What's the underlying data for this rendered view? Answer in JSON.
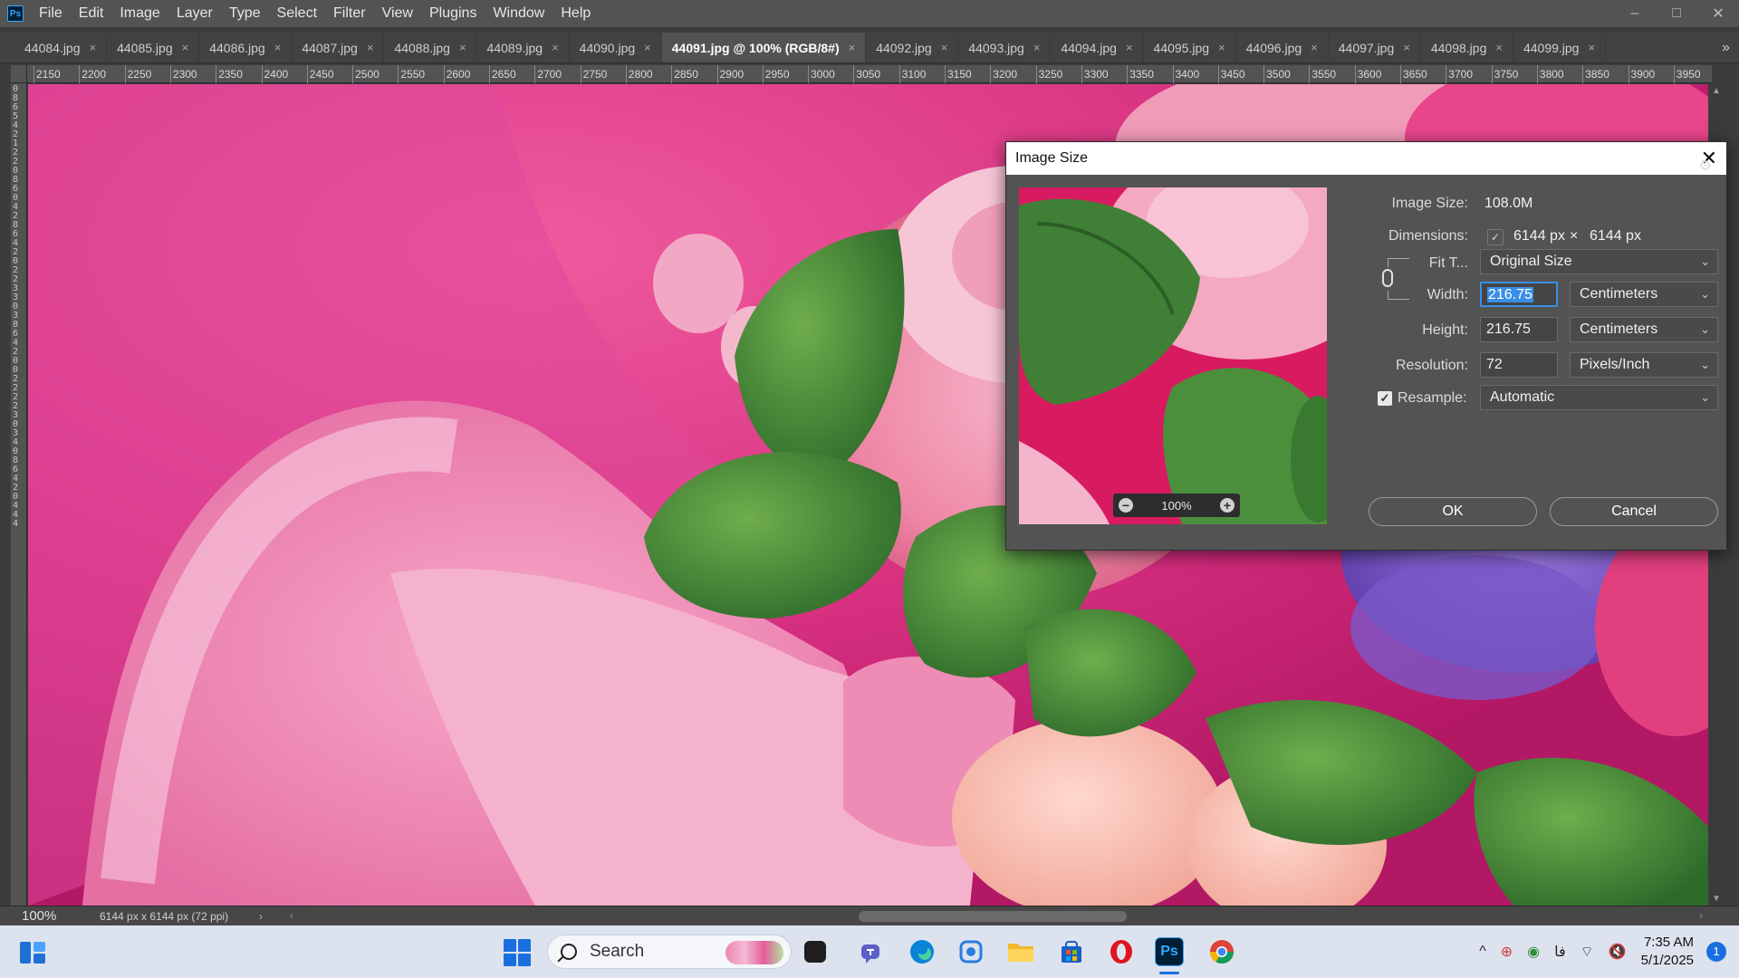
{
  "app": {
    "logo": "Ps",
    "menu": [
      "File",
      "Edit",
      "Image",
      "Layer",
      "Type",
      "Select",
      "Filter",
      "View",
      "Plugins",
      "Window",
      "Help"
    ],
    "window_controls": {
      "minimize": "–",
      "maximize": "□",
      "close": "✕"
    }
  },
  "tabs": [
    {
      "label": "44084.jpg",
      "active": false
    },
    {
      "label": "44085.jpg",
      "active": false
    },
    {
      "label": "44086.jpg",
      "active": false
    },
    {
      "label": "44087.jpg",
      "active": false
    },
    {
      "label": "44088.jpg",
      "active": false
    },
    {
      "label": "44089.jpg",
      "active": false
    },
    {
      "label": "44090.jpg",
      "active": false
    },
    {
      "label": "44091.jpg @ 100% (RGB/8#)",
      "active": true
    },
    {
      "label": "44092.jpg",
      "active": false
    },
    {
      "label": "44093.jpg",
      "active": false
    },
    {
      "label": "44094.jpg",
      "active": false
    },
    {
      "label": "44095.jpg",
      "active": false
    },
    {
      "label": "44096.jpg",
      "active": false
    },
    {
      "label": "44097.jpg",
      "active": false
    },
    {
      "label": "44098.jpg",
      "active": false
    },
    {
      "label": "44099.jpg",
      "active": false
    }
  ],
  "tab_close": "×",
  "tab_overflow": "»",
  "ruler_top": [
    "2150",
    "2200",
    "2250",
    "2300",
    "2350",
    "2400",
    "2450",
    "2500",
    "2550",
    "2600",
    "2650",
    "2700",
    "2750",
    "2800",
    "2850",
    "2900",
    "2950",
    "3000",
    "3050",
    "3100",
    "3150",
    "3200",
    "3250",
    "3300",
    "3350",
    "3400",
    "3450",
    "3500",
    "3550",
    "3600",
    "3650",
    "3700",
    "3750",
    "3800",
    "3850",
    "3900",
    "3950"
  ],
  "ruler_left_digits": "0865421220860428642022330386420022223034086420444",
  "status": {
    "zoom": "100%",
    "doc_info": "6144 px x 6144 px (72 ppi)",
    "arrow": "›"
  },
  "dialog": {
    "title": "Image Size",
    "close": "✕",
    "gear": "⚙",
    "image_size_label": "Image Size:",
    "image_size_value": "108.0M",
    "dimensions_label": "Dimensions:",
    "dimensions_width": "6144 px",
    "dimensions_sep": "×",
    "dimensions_height": "6144 px",
    "fit_to_label": "Fit T...",
    "fit_to_value": "Original Size",
    "width_label": "Width:",
    "width_value": "216.75",
    "width_unit": "Centimeters",
    "height_label": "Height:",
    "height_value": "216.75",
    "height_unit": "Centimeters",
    "resolution_label": "Resolution:",
    "resolution_value": "72",
    "resolution_unit": "Pixels/Inch",
    "resample_label": "Resample:",
    "resample_checked": true,
    "resample_value": "Automatic",
    "preview_zoom": "100%",
    "ok_label": "OK",
    "cancel_label": "Cancel"
  },
  "taskbar": {
    "search_label": "Search",
    "apps": [
      "task-view",
      "teams",
      "edge",
      "copilot",
      "file-explorer",
      "microsoft-store",
      "opera",
      "photoshop",
      "chrome"
    ],
    "tray": {
      "chevron": "^",
      "lang": "فا",
      "time": "7:35 AM",
      "date": "5/1/2025",
      "notifications": "1"
    }
  }
}
